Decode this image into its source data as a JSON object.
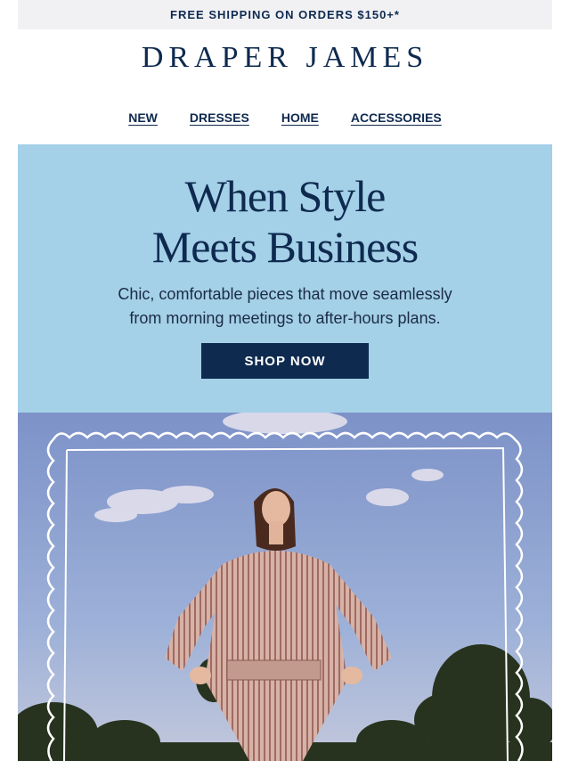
{
  "banner": {
    "text": "FREE SHIPPING ON ORDERS $150+*"
  },
  "brand": {
    "logo": "DRAPER JAMES"
  },
  "nav": {
    "items": [
      "NEW",
      "DRESSES",
      "HOME",
      "ACCESSORIES"
    ]
  },
  "hero": {
    "headline_line1": "When Style",
    "headline_line2": "Meets Business",
    "body_line1": "Chic, comfortable pieces that move seamlessly",
    "body_line2": "from morning meetings to after-hours plans.",
    "cta_label": "SHOP NOW",
    "background_color": "#a4d0e8",
    "button_color": "#0e2a4f"
  },
  "colors": {
    "navy": "#0e2a4f",
    "banner_bg": "#f1f1f4"
  }
}
